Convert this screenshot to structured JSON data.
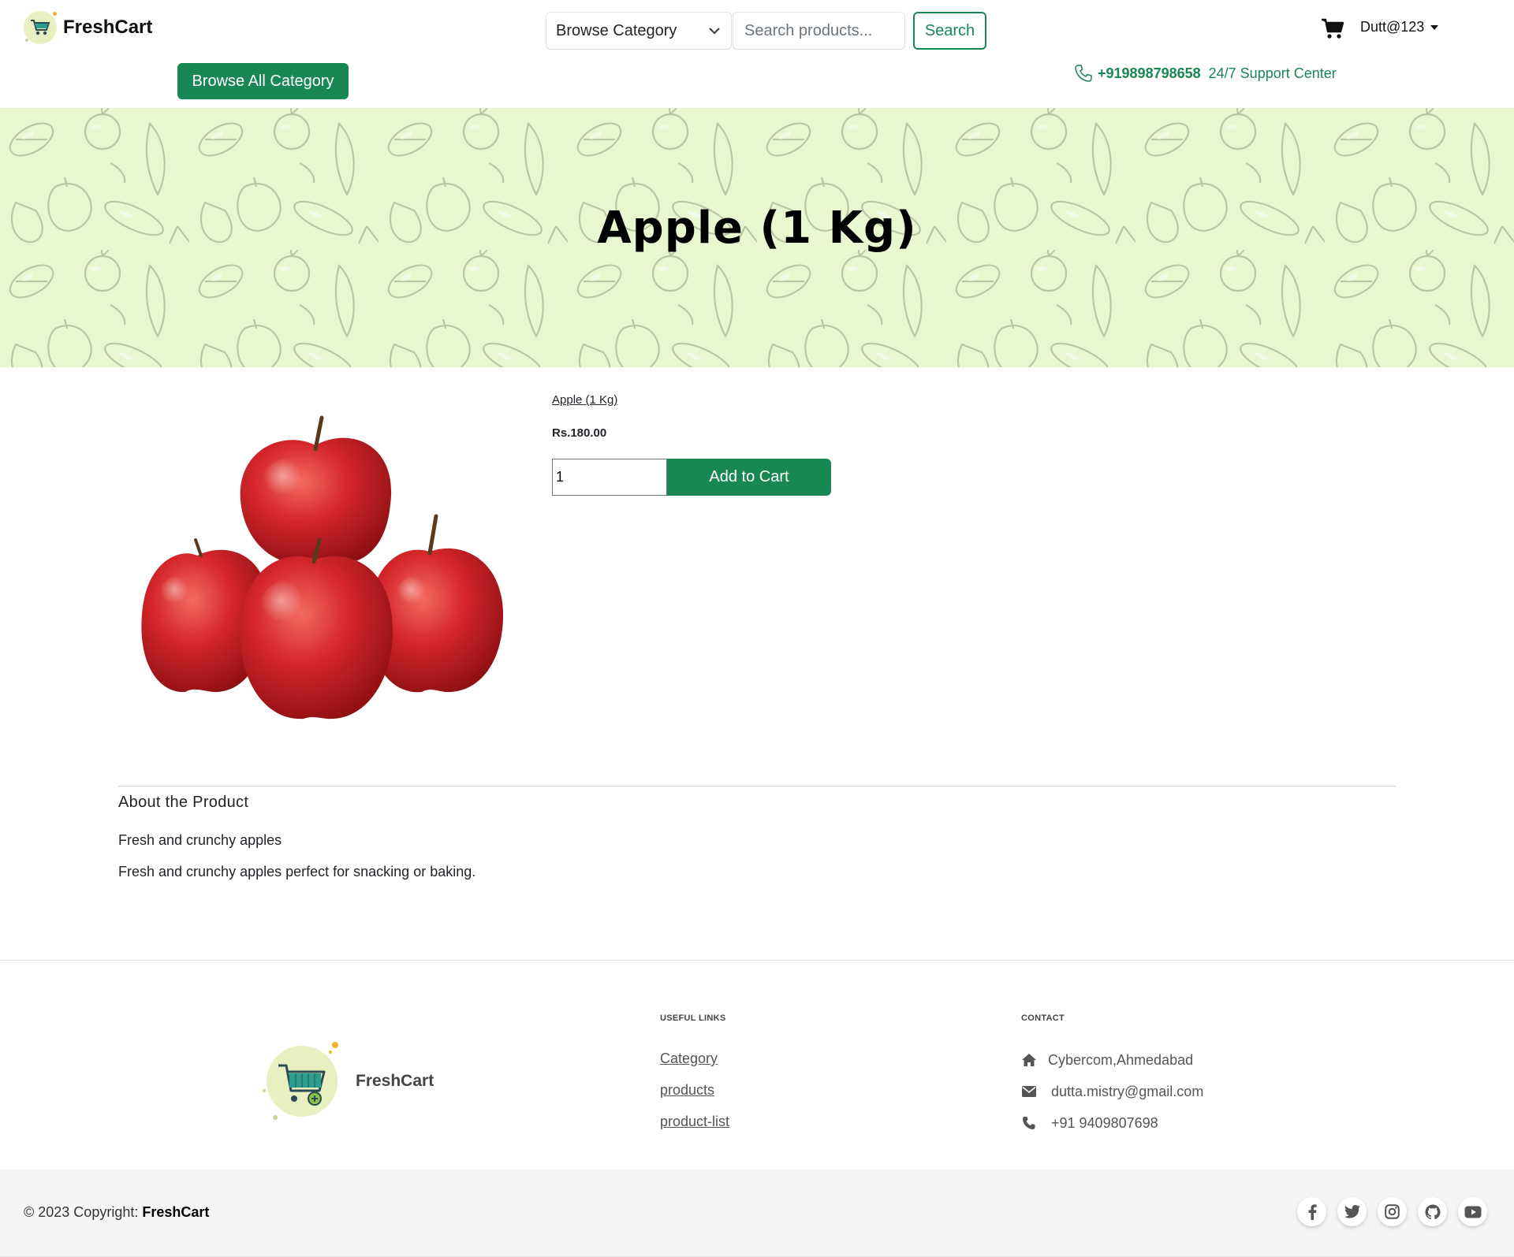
{
  "header": {
    "logo_text": "FreshCart",
    "category_select": "Browse Category",
    "search_placeholder": "Search products...",
    "search_label": "Search",
    "user_label": "Dutt@123",
    "browse_all_label": "Browse All Category",
    "support_phone": "+919898798658",
    "support_text": "24/7 Support Center"
  },
  "hero": {
    "title": "Apple (1 Kg)"
  },
  "product": {
    "name": "Apple (1 Kg)",
    "price": "Rs.180.00",
    "quantity": "1",
    "add_to_cart_label": "Add to Cart"
  },
  "about": {
    "heading": "About the Product",
    "short_description": "Fresh and crunchy apples",
    "long_description": "Fresh and crunchy apples perfect for snacking or baking."
  },
  "footer": {
    "logo_text": "FreshCart",
    "useful_links_heading": "USEFUL LINKS",
    "useful_links": [
      "Category",
      "products",
      "product-list"
    ],
    "contact_heading": "CONTACT",
    "contact": {
      "address": "Cybercom,Ahmedabad",
      "email": "dutta.mistry@gmail.com",
      "phone": "+91 9409807698"
    },
    "copyright_prefix": "© 2023 Copyright:",
    "copyright_brand": "FreshCart",
    "social_icons": [
      "facebook-icon",
      "twitter-icon",
      "instagram-icon",
      "github-icon",
      "youtube-icon"
    ]
  },
  "colors": {
    "brand_green": "#198754",
    "hero_background": "#e9f7d0"
  }
}
